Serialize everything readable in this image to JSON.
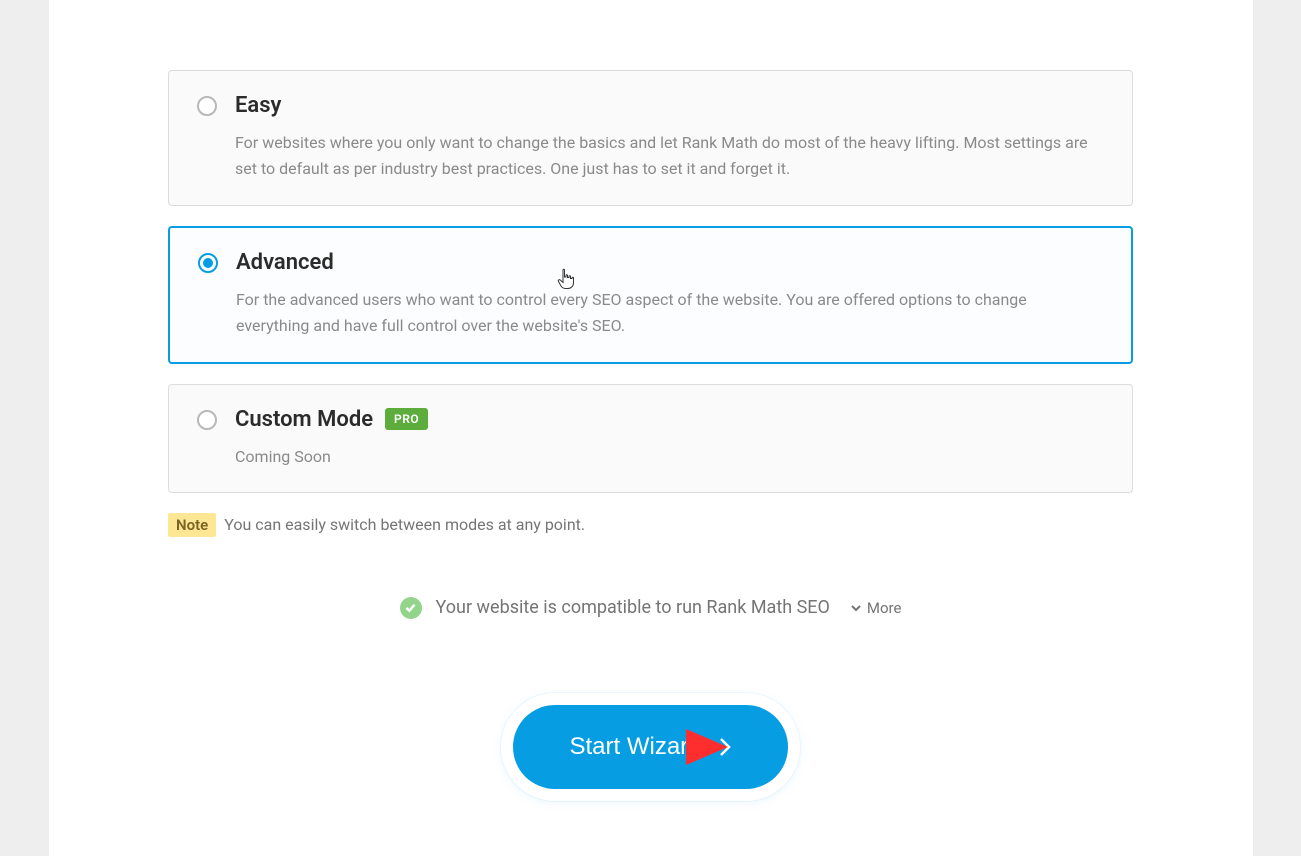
{
  "options": {
    "easy": {
      "title": "Easy",
      "desc": "For websites where you only want to change the basics and let Rank Math do most of the heavy lifting. Most settings are set to default as per industry best practices. One just has to set it and forget it.",
      "selected": false
    },
    "advanced": {
      "title": "Advanced",
      "desc": "For the advanced users who want to control every SEO aspect of the website. You are offered options to change everything and have full control over the website's SEO.",
      "selected": true
    },
    "custom": {
      "title": "Custom Mode",
      "badge": "PRO",
      "desc": "Coming Soon",
      "selected": false
    }
  },
  "note": {
    "label": "Note",
    "text": "You can easily switch between modes at any point."
  },
  "compatibility": {
    "text": "Your website is compatible to run Rank Math SEO",
    "more_label": "More"
  },
  "cta": {
    "label": "Start Wizard"
  }
}
